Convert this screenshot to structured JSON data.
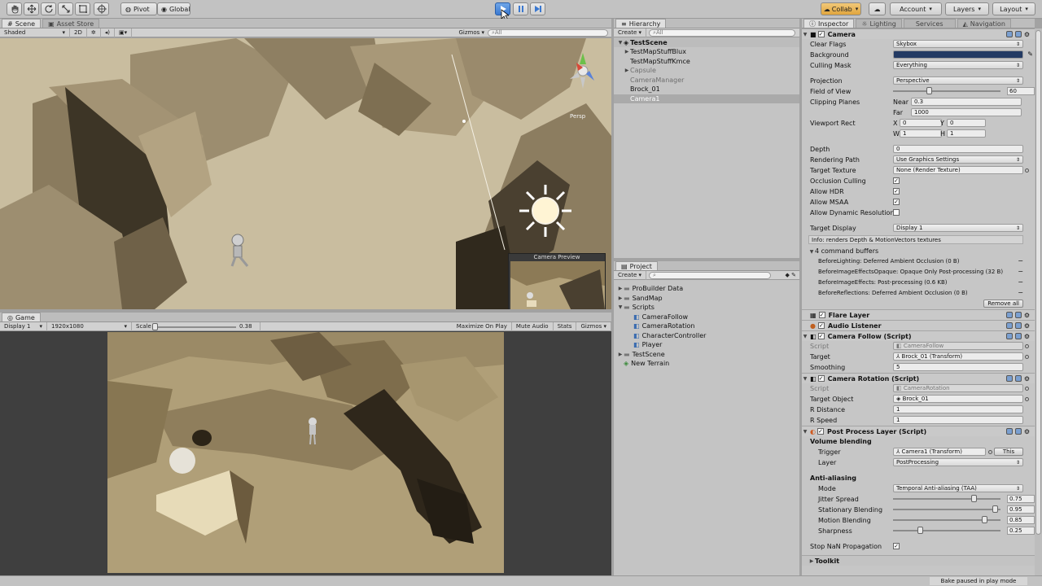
{
  "toolbar": {
    "pivot": "Pivot",
    "global": "Global",
    "collab": "Collab",
    "account": "Account",
    "layers": "Layers",
    "layout": "Layout"
  },
  "scene": {
    "tab_scene": "Scene",
    "tab_asset_store": "Asset Store",
    "shaded": "Shaded",
    "mode_2d": "2D",
    "gizmos": "Gizmos",
    "search_placeholder": "All",
    "persp": "Persp",
    "camera_preview": "Camera Preview"
  },
  "game": {
    "tab": "Game",
    "display": "Display 1",
    "resolution": "1920x1080",
    "scale_label": "Scale",
    "scale_value": "0.38",
    "scale_fraction": 0.38,
    "maximize": "Maximize On Play",
    "mute": "Mute Audio",
    "stats": "Stats",
    "gizmos": "Gizmos"
  },
  "hierarchy": {
    "tab": "Hierarchy",
    "create": "Create",
    "search_placeholder": "All",
    "scene_name": "TestScene",
    "items": [
      {
        "label": "TestMapStuffBlux",
        "expandable": true,
        "grey": false,
        "selected": false
      },
      {
        "label": "TestMapStuffKmce",
        "expandable": false,
        "grey": false,
        "selected": false
      },
      {
        "label": "Capsule",
        "expandable": true,
        "grey": true,
        "selected": false
      },
      {
        "label": "CameraManager",
        "expandable": false,
        "grey": true,
        "selected": false
      },
      {
        "label": "Brock_01",
        "expandable": false,
        "grey": false,
        "selected": false
      },
      {
        "label": "Camera1",
        "expandable": false,
        "grey": false,
        "selected": true
      }
    ]
  },
  "project": {
    "tab": "Project",
    "create": "Create",
    "items": [
      {
        "label": "ProBuilder Data",
        "level": 0,
        "expandable": true,
        "kind": "folder"
      },
      {
        "label": "SandMap",
        "level": 0,
        "expandable": true,
        "kind": "folder"
      },
      {
        "label": "Scripts",
        "level": 0,
        "expandable": true,
        "kind": "folder"
      },
      {
        "label": "CameraFollow",
        "level": 1,
        "expandable": false,
        "kind": "script"
      },
      {
        "label": "CameraRotation",
        "level": 1,
        "expandable": false,
        "kind": "script"
      },
      {
        "label": "CharacterController",
        "level": 1,
        "expandable": false,
        "kind": "script"
      },
      {
        "label": "Player",
        "level": 1,
        "expandable": false,
        "kind": "script"
      },
      {
        "label": "TestScene",
        "level": 0,
        "expandable": true,
        "kind": "folder"
      },
      {
        "label": "New Terrain",
        "level": 0,
        "expandable": false,
        "kind": "terrain"
      }
    ]
  },
  "inspector": {
    "tabs": [
      "Inspector",
      "Lighting",
      "Services",
      "Navigation"
    ],
    "camera": {
      "title": "Camera",
      "clear_flags_label": "Clear Flags",
      "clear_flags": "Skybox",
      "background_label": "Background",
      "background_color": "#233a63",
      "culling_mask_label": "Culling Mask",
      "culling_mask": "Everything",
      "projection_label": "Projection",
      "projection": "Perspective",
      "fov_label": "Field of View",
      "fov": "60",
      "fov_fraction": 0.33,
      "clipping_label": "Clipping Planes",
      "near_label": "Near",
      "near": "0.3",
      "far_label": "Far",
      "far": "1000",
      "viewport_label": "Viewport Rect",
      "x_label": "X",
      "x": "0",
      "y_label": "Y",
      "y": "0",
      "w_label": "W",
      "w": "1",
      "h_label": "H",
      "h": "1",
      "depth_label": "Depth",
      "depth": "0",
      "rendering_path_label": "Rendering Path",
      "rendering_path": "Use Graphics Settings",
      "target_texture_label": "Target Texture",
      "target_texture": "None (Render Texture)",
      "occlusion_label": "Occlusion Culling",
      "hdr_label": "Allow HDR",
      "msaa_label": "Allow MSAA",
      "dynres_label": "Allow Dynamic Resolution",
      "target_display_label": "Target Display",
      "target_display": "Display 1",
      "info": "Info: renders Depth & MotionVectors textures",
      "command_buffers": "4 command buffers",
      "buffers": [
        "BeforeLighting: Deferred Ambient Occlusion (0 B)",
        "BeforeImageEffectsOpaque: Opaque Only Post-processing (32 B)",
        "BeforeImageEffects: Post-processing (0.6 KB)",
        "BeforeReflections: Deferred Ambient Occlusion (0 B)"
      ],
      "remove_all": "Remove all"
    },
    "flare_layer": "Flare Layer",
    "audio_listener": "Audio Listener",
    "camera_follow": {
      "title": "Camera Follow (Script)",
      "script_label": "Script",
      "script": "CameraFollow",
      "target_label": "Target",
      "target": "Brock_01 (Transform)",
      "smoothing_label": "Smoothing",
      "smoothing": "5"
    },
    "camera_rotation": {
      "title": "Camera Rotation (Script)",
      "script_label": "Script",
      "script": "CameraRotation",
      "target_label": "Target Object",
      "target": "Brock_01",
      "rdistance_label": "R Distance",
      "rdistance": "1",
      "rspeed_label": "R Speed",
      "rspeed": "1"
    },
    "post_process": {
      "title": "Post Process Layer (Script)",
      "volume_blending": "Volume blending",
      "trigger_label": "Trigger",
      "trigger": "Camera1 (Transform)",
      "this_btn": "This",
      "layer_label": "Layer",
      "layer": "PostProcessing",
      "antialiasing": "Anti-aliasing",
      "mode_label": "Mode",
      "mode": "Temporal Anti-aliasing (TAA)",
      "jitter_label": "Jitter Spread",
      "jitter": "0.75",
      "jitter_fraction": 0.75,
      "stationary_label": "Stationary Blending",
      "stationary": "0.95",
      "stationary_fraction": 0.95,
      "motion_label": "Motion Blending",
      "motion": "0.85",
      "motion_fraction": 0.85,
      "sharpness_label": "Sharpness",
      "sharpness": "0.25",
      "sharpness_fraction": 0.25,
      "stop_nan_label": "Stop NaN Propagation",
      "toolkit": "Toolkit"
    }
  },
  "status": {
    "bake": "Bake paused in play mode"
  }
}
